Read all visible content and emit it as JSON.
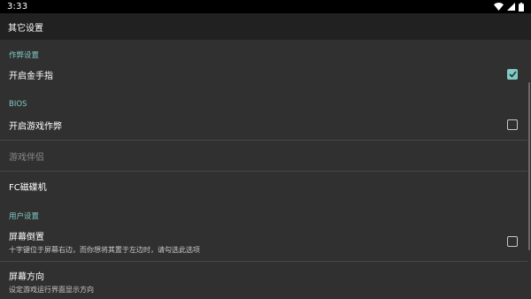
{
  "status_bar": {
    "time": "3:33"
  },
  "app_bar": {
    "title": "其它设置"
  },
  "sections": {
    "cheat": {
      "header": "作弊设置",
      "golden_finger": {
        "title": "开启金手指",
        "checked": true
      }
    },
    "bios": {
      "header": "BIOS",
      "game_cheat": {
        "title": "开启游戏作弊",
        "checked": false
      },
      "game_partner": {
        "title": "游戏伴侣",
        "enabled": false
      },
      "fc_disk": {
        "title": "FC磁碟机"
      }
    },
    "user": {
      "header": "用户设置",
      "flip_screen": {
        "title": "屏幕倒置",
        "summary": "十字键位于屏幕右边，而你想将其置于左边时，请勾选此选项",
        "checked": false
      },
      "orientation": {
        "title": "屏幕方向",
        "summary": "设定游戏运行界面显示方向"
      }
    }
  },
  "colors": {
    "accent": "#80cbc4",
    "background": "#303030",
    "app_bar": "#212121"
  }
}
